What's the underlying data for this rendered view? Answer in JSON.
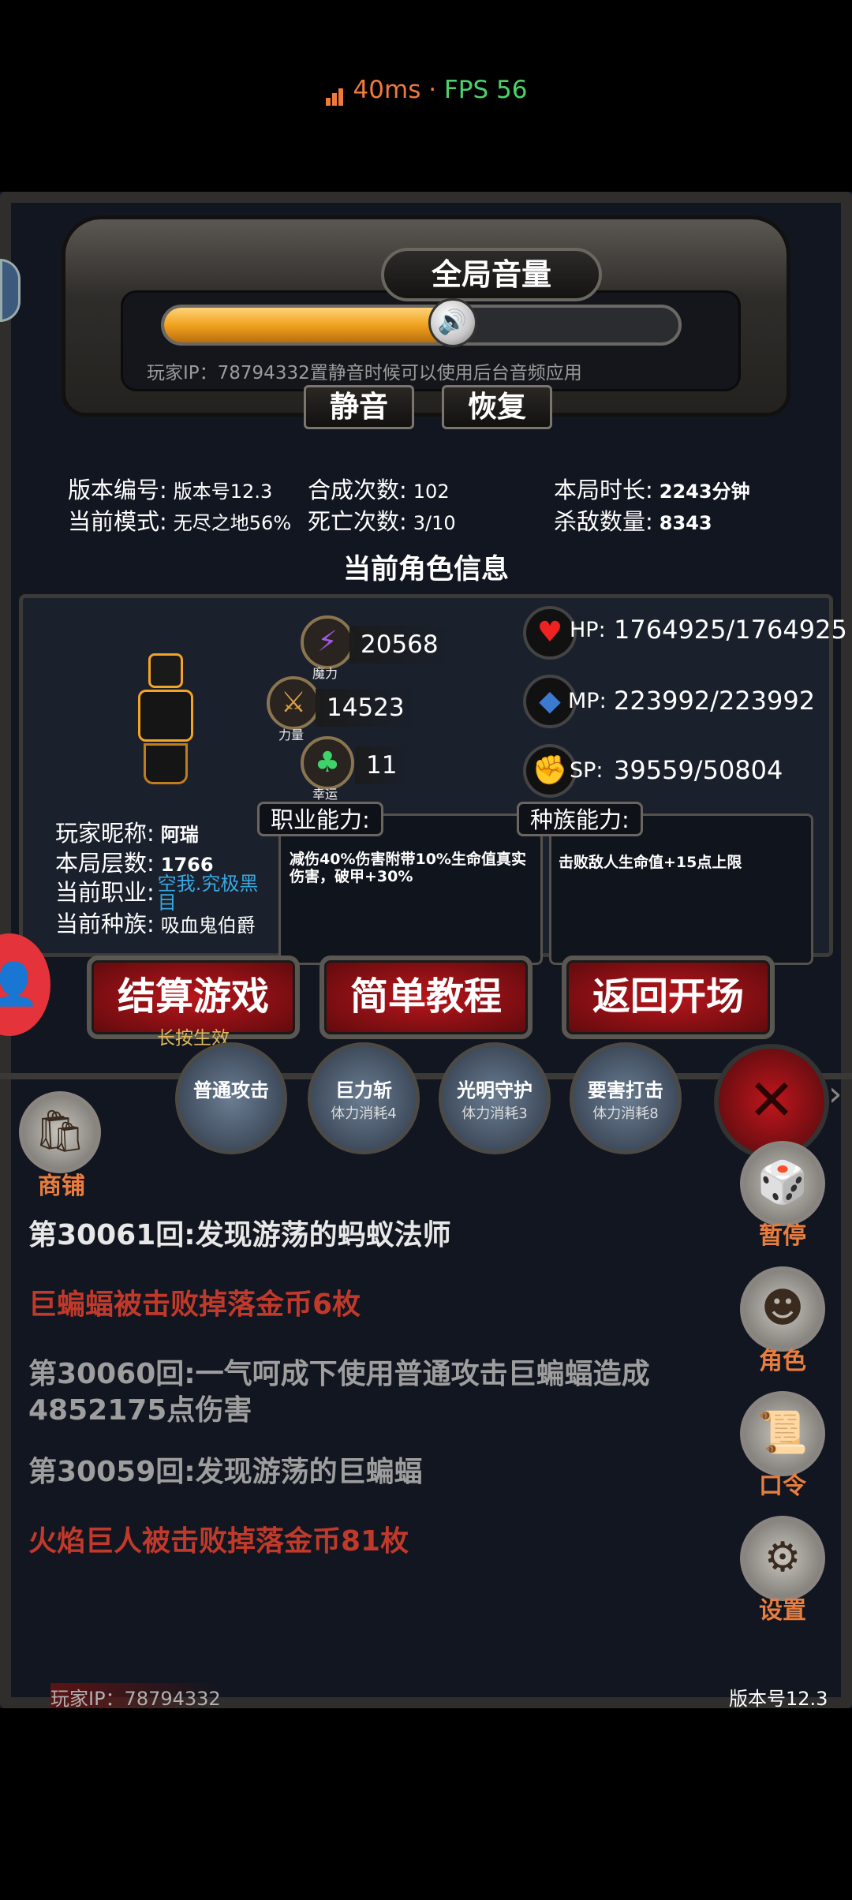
{
  "status": {
    "ping": "40ms",
    "sep": "·",
    "fps": "FPS 56"
  },
  "volume": {
    "title": "全局音量",
    "level": 0.56,
    "ip_hint": "玩家IP：78794332",
    "hint": "置静音时候可以使用后台音频应用",
    "mute_label": "静音",
    "restore_label": "恢复"
  },
  "stats": {
    "version_label": "版本编号:",
    "version_value": "版本号12.3",
    "mode_label": "当前模式:",
    "mode_value": "无尽之地56%",
    "craft_label": "合成次数:",
    "craft_value": "102",
    "death_label": "死亡次数:",
    "death_value": "3/10",
    "time_label": "本局时长:",
    "time_value": "2243分钟",
    "kills_label": "杀敌数量:",
    "kills_value": "8343"
  },
  "character": {
    "section_title": "当前角色信息",
    "magic_value": "20568",
    "magic_label": "魔力",
    "strength_value": "14523",
    "strength_label": "力量",
    "luck_value": "11",
    "luck_label": "幸运",
    "hp_label": "HP:",
    "hp_value": "1764925/1764925",
    "mp_label": "MP:",
    "mp_value": "223992/223992",
    "sp_label": "SP:",
    "sp_value": "39559/50804",
    "nickname_label": "玩家昵称:",
    "nickname_value": "阿瑞",
    "floor_label": "本局层数:",
    "floor_value": "1766",
    "class_label": "当前职业:",
    "class_value": "空我.究极黑目",
    "race_label": "当前种族:",
    "race_value": "吸血鬼伯爵",
    "job_ability_label": "职业能力:",
    "job_ability_text": "减伤40%伤害附带10%生命值真实伤害，破甲+30%",
    "race_ability_label": "种族能力:",
    "race_ability_text": "击败敌人生命值+15点上限"
  },
  "actions": {
    "settle_label": "结算游戏",
    "settle_hint": "长按生效",
    "tutorial_label": "简单教程",
    "back_label": "返回开场"
  },
  "skills": [
    {
      "name": "普通攻击",
      "cost": ""
    },
    {
      "name": "巨力斩",
      "cost": "体力消耗4"
    },
    {
      "name": "光明守护",
      "cost": "体力消耗3"
    },
    {
      "name": "要害打击",
      "cost": "体力消耗8"
    }
  ],
  "shop_label": "商铺",
  "side": {
    "pause": "暂停",
    "role": "角色",
    "code": "口令",
    "settings": "设置"
  },
  "log": [
    {
      "text": "第30061回:发现游荡的蚂蚁法师",
      "color": "#e8e8e8"
    },
    {
      "text": "巨蝙蝠被击败掉落金币6枚",
      "color": "#c0392b"
    },
    {
      "text": "第30060回:一气呵成下使用普通攻击巨蝙蝠造成4852175点伤害",
      "color": "#9e9e9e"
    },
    {
      "text": "第30059回:发现游荡的巨蝙蝠",
      "color": "#9e9e9e"
    },
    {
      "text": "火焰巨人被击败掉落金币81枚",
      "color": "#c0392b"
    }
  ],
  "footer": {
    "ip": "玩家IP：78794332",
    "version": "版本号12.3"
  },
  "colors": {
    "orange": "#f07a3c",
    "green": "#4bd26b",
    "log_red": "#c0392b",
    "class_blue": "#3aa7e0"
  }
}
